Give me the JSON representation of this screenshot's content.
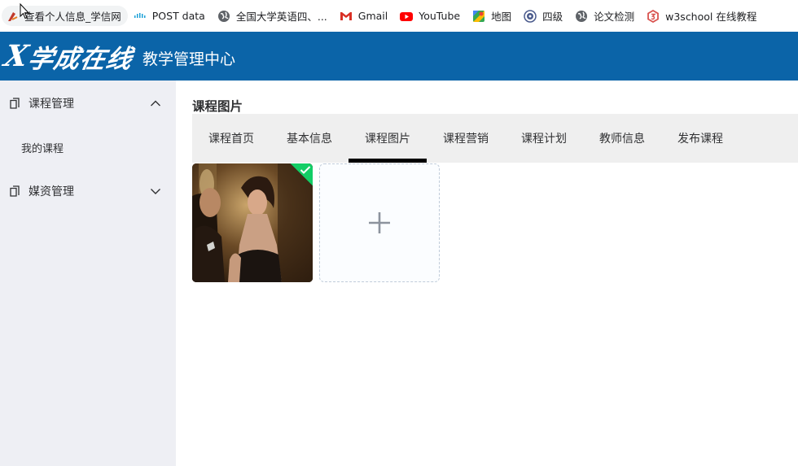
{
  "bookmarks": [
    {
      "label": "查看个人信息_学信网",
      "icon": "chsi-icon",
      "color": "#c0392b"
    },
    {
      "label": "POST data",
      "icon": "cisco-icon",
      "color": "#1ba0d7"
    },
    {
      "label": "全国大学英语四、...",
      "icon": "globe-icon",
      "color": "#5f6368"
    },
    {
      "label": "Gmail",
      "icon": "gmail-icon",
      "color": "#d93025"
    },
    {
      "label": "YouTube",
      "icon": "youtube-icon",
      "color": "#ff0000"
    },
    {
      "label": "地图",
      "icon": "maps-icon",
      "color": "#34a853"
    },
    {
      "label": "四级",
      "icon": "cet-icon",
      "color": "#4a5a8c"
    },
    {
      "label": "论文检测",
      "icon": "globe-icon",
      "color": "#5f6368"
    },
    {
      "label": "w3school 在线教程",
      "icon": "w3school-icon",
      "color": "#d9534f"
    }
  ],
  "header": {
    "logo_mark": "X",
    "logo_text": "学成在线",
    "title": "教学管理中心",
    "bg_color": "#0b64a8"
  },
  "sidebar": {
    "bg_color": "#eeeff4",
    "menus": [
      {
        "label": "课程管理",
        "expanded": true,
        "items": [
          "我的课程"
        ]
      },
      {
        "label": "媒资管理",
        "expanded": false,
        "items": []
      }
    ]
  },
  "main": {
    "page_title": "课程图片",
    "tabs": [
      {
        "label": "课程首页",
        "active": false
      },
      {
        "label": "基本信息",
        "active": false
      },
      {
        "label": "课程图片",
        "active": true
      },
      {
        "label": "课程营销",
        "active": false
      },
      {
        "label": "课程计划",
        "active": false
      },
      {
        "label": "教师信息",
        "active": false
      },
      {
        "label": "发布课程",
        "active": false
      }
    ],
    "uploaded_picture": {
      "status": "success",
      "status_color": "#13ce66"
    },
    "upload_button_icon": "plus-icon"
  }
}
